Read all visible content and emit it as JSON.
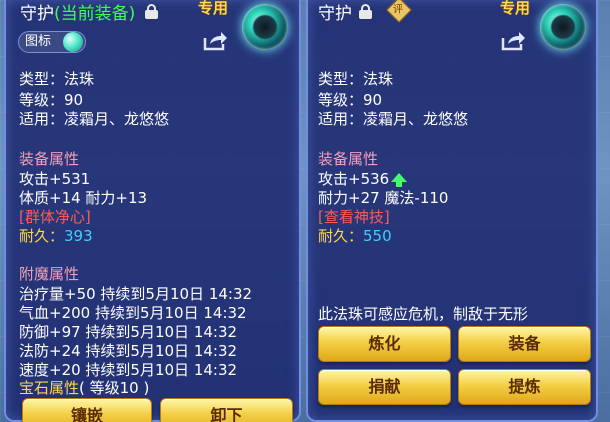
{
  "left_panel": {
    "title": "守护",
    "title_sub": "(当前装备)",
    "badge": "专用",
    "icon_label": "图标",
    "type_line": "类型：法珠",
    "level_line": "等级：90",
    "apply_line": "适用：凌霜月、龙悠悠",
    "equip_attr_heading": "装备属性",
    "attack_line": "攻击+531",
    "stats_line": "体质+14 耐力+13",
    "skill_line": "[群体净心]",
    "durability_label": "耐久：",
    "durability_value": "393",
    "enchant_heading": "附魔属性",
    "enchants": [
      "治疗量+50 持续到5月10日 14:32",
      "气血+200 持续到5月10日 14:32",
      "防御+97 持续到5月10日 14:32",
      "法防+24 持续到5月10日 14:32",
      "速度+20 持续到5月10日 14:32"
    ],
    "gem_heading": "宝石属性",
    "gem_level": "( 等级10 )",
    "buttons": [
      "镶嵌",
      "卸下"
    ]
  },
  "right_panel": {
    "title": "守护",
    "seal_char": "评",
    "badge": "专用",
    "type_line": "类型：法珠",
    "level_line": "等级：90",
    "apply_line": "适用：凌霜月、龙悠悠",
    "equip_attr_heading": "装备属性",
    "attack_line": "攻击+536",
    "stats_line": "耐力+27 魔法-110",
    "skill_line": "[查看神技]",
    "durability_label": "耐久：",
    "durability_value": "550",
    "description": "此法珠可感应危机，制敌于无形",
    "buttons": [
      "炼化",
      "装备",
      "捐献",
      "提炼"
    ]
  },
  "colors": {
    "panel_bg": "#1c286e",
    "heading_pink": "#f0a0b8",
    "skill_red": "#ff5a5a",
    "durability_yellow": "#ffd84a",
    "durability_value_cyan": "#3cd3ff",
    "current_equip_green": "#3dff52",
    "button_gold": "#f3cf45"
  },
  "icons": [
    "lock-icon",
    "share-icon",
    "gem-icon",
    "orb-icon",
    "arrow-up-icon",
    "seal-icon"
  ]
}
